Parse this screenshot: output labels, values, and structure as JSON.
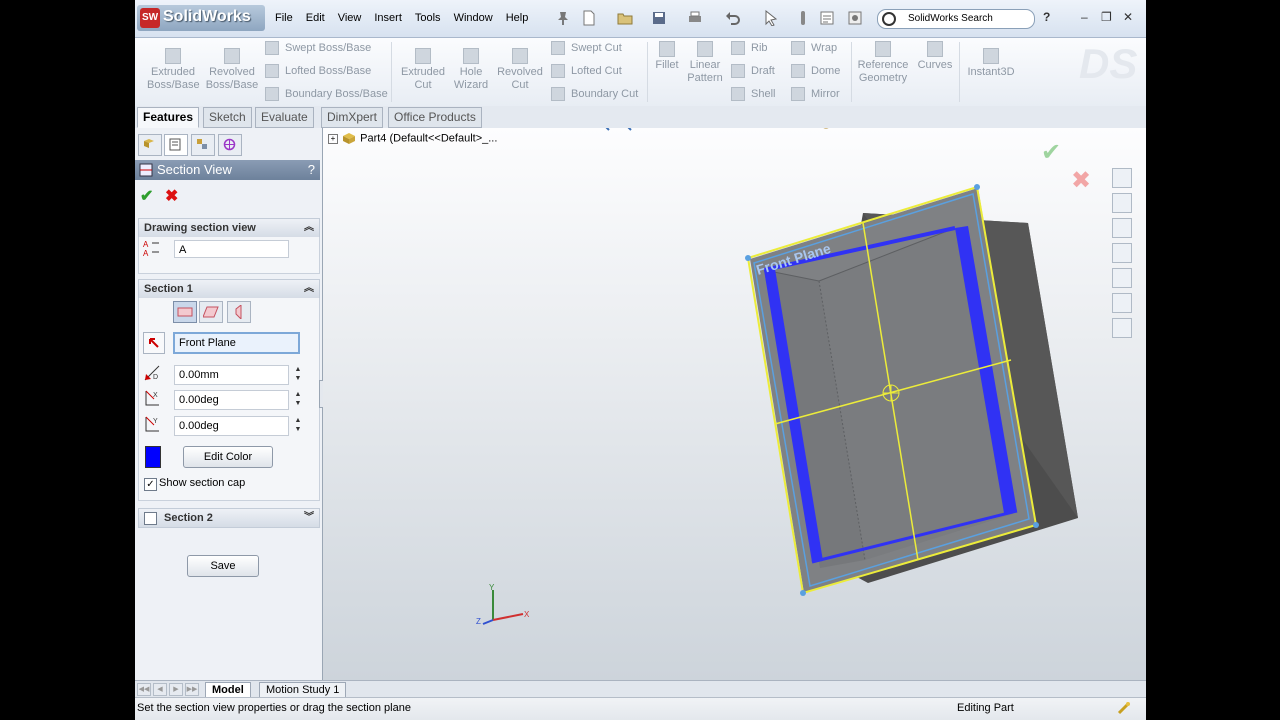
{
  "app": {
    "logo_text": "SolidWorks",
    "search_placeholder": "SolidWorks Search"
  },
  "menu": [
    "File",
    "Edit",
    "View",
    "Insert",
    "Tools",
    "Window",
    "Help"
  ],
  "ribbon": {
    "extruded_boss": [
      "Extruded",
      "Boss/Base"
    ],
    "revolved_boss": [
      "Revolved",
      "Boss/Base"
    ],
    "swept_boss": "Swept Boss/Base",
    "lofted_boss": "Lofted Boss/Base",
    "boundary_boss": "Boundary Boss/Base",
    "extruded_cut": [
      "Extruded",
      "Cut"
    ],
    "hole_wizard": [
      "Hole",
      "Wizard"
    ],
    "revolved_cut": [
      "Revolved",
      "Cut"
    ],
    "swept_cut": "Swept Cut",
    "lofted_cut": "Lofted Cut",
    "boundary_cut": "Boundary Cut",
    "fillet": "Fillet",
    "linear_pattern": [
      "Linear",
      "Pattern"
    ],
    "rib": "Rib",
    "draft": "Draft",
    "shell": "Shell",
    "wrap": "Wrap",
    "dome": "Dome",
    "mirror": "Mirror",
    "reference_geometry": [
      "Reference",
      "Geometry"
    ],
    "curves": "Curves",
    "instant3d": "Instant3D"
  },
  "tabs": [
    "Features",
    "Sketch",
    "Evaluate",
    "DimXpert",
    "Office Products"
  ],
  "property_manager": {
    "title": "Section View",
    "help": "?",
    "drawing_section_view": {
      "header": "Drawing section view",
      "name_value": "A"
    },
    "section1": {
      "header": "Section 1",
      "plane_value": "Front Plane",
      "offset_value": "0.00mm",
      "rot_x_value": "0.00deg",
      "rot_y_value": "0.00deg",
      "edit_color_label": "Edit Color",
      "show_cap_label": "Show section cap",
      "show_cap_checked": "✓",
      "cap_color": "#0000ff"
    },
    "section2": {
      "header": "Section 2"
    },
    "save_label": "Save"
  },
  "viewport": {
    "tree_label": "Part4  (Default<<Default>_...",
    "plane_label": "Front Plane",
    "triad": {
      "x": "X",
      "y": "Y",
      "z": "Z"
    }
  },
  "bottom_tabs": [
    "Model",
    "Motion Study 1"
  ],
  "status": {
    "message": "Set the section view properties or drag the section plane",
    "mode": "Editing Part"
  },
  "colors": {
    "accent_blue": "#0000ff",
    "section_line": "#ecec3a",
    "model_gray": "#626262"
  }
}
